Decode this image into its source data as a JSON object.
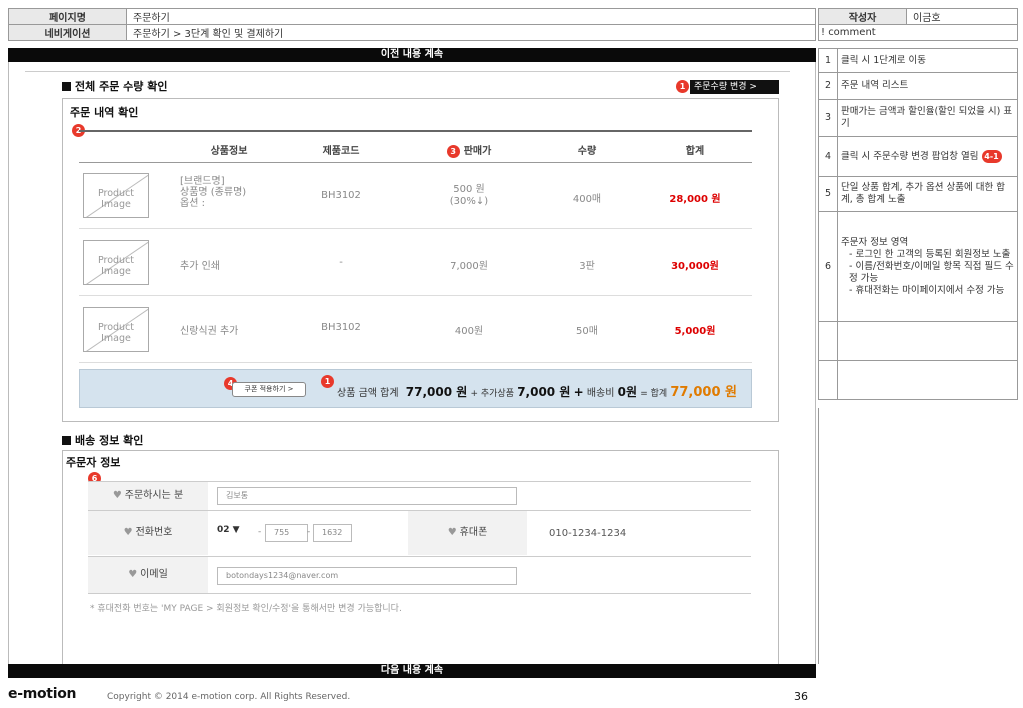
{
  "header": {
    "page_label": "페이지명",
    "page_value": "주문하기",
    "nav_label": "네비게이션",
    "nav_value": "주문하기 > 3단계 확인 및 결제하기",
    "author_label": "작성자",
    "author_value": "이금호",
    "comment_label": "! comment"
  },
  "bars": {
    "top": "이전 내용 계속",
    "bottom": "다음 내용 계속"
  },
  "comments": [
    {
      "num": "1",
      "text": "클릭 시 1단계로 이동"
    },
    {
      "num": "2",
      "text": "주문 내역 리스트"
    },
    {
      "num": "3",
      "text": "판매가는 금액과 할인율(할인 되었을 시) 표기"
    },
    {
      "num": "4",
      "text": "클릭 시 주문수량 변경 팝업창 열림",
      "badge": "4-1"
    },
    {
      "num": "5",
      "text": "단일 상품 합계, 추가 옵션 상품에 대한 합계, 총 합계 노출"
    },
    {
      "num": "6",
      "title": "주문자 정보 영역",
      "bullets": [
        "로그인 한 고객의 등록된 회원정보 노출",
        "이름/전화번호/이메일 항목 직접 필드 수정 가능",
        "휴대전화는 마이페이지에서 수정 가능"
      ]
    }
  ],
  "order": {
    "section_title": "전체 주문 수량 확인",
    "change_qty_badge": "1",
    "change_qty_button": "주문수량 변경 >",
    "subtitle": "주문 내역 확인",
    "list_badge": "2",
    "price_badge": "3",
    "columns": [
      "상품정보",
      "제품코드",
      "판매가",
      "수량",
      "합계"
    ],
    "image_placeholder": "Product Image",
    "rows": [
      {
        "info": [
          "[브랜드명]",
          "상품명 (종류명)",
          "옵션 :"
        ],
        "code": "BH3102",
        "price": [
          "500 원",
          "(30%↓)"
        ],
        "qty": "400매",
        "total": "28,000 원"
      },
      {
        "info": [
          "추가 인쇄"
        ],
        "code": "-",
        "price": [
          "7,000원"
        ],
        "qty": "3판",
        "total": "30,000원"
      },
      {
        "info": [
          "신랑식권 추가"
        ],
        "code": "BH3102",
        "price": [
          "400원"
        ],
        "qty": "50매",
        "total": "5,000원"
      }
    ],
    "summary": {
      "coupon_badge": "4",
      "coupon_button": "쿠폰 적용하기 >",
      "sum_badge": "1",
      "product_label": "상품 금액 합계",
      "product_amount": "77,000 원",
      "plus1": "+ 추가상품",
      "extra_amount": "7,000 원",
      "plus2": "+",
      "ship_label": "배송비",
      "ship_amount": "0원",
      "eq_label": "= 합계",
      "total_amount": "77,000 원"
    }
  },
  "delivery": {
    "section_title": "배송 정보 확인",
    "subtitle": "주문자 정보",
    "badge": "6",
    "name_label": "주문하시는 분",
    "name_value": "김보통",
    "phone_label": "전화번호",
    "phone_prefix": "02",
    "phone_mid": "755",
    "phone_last": "1632",
    "mobile_label": "휴대폰",
    "mobile_value": "010-1234-1234",
    "email_label": "이메일",
    "email_value": "botondays1234@naver.com",
    "note": "* 휴대전화 번호는 'MY PAGE > 회원정보 확인/수정'을 통해서만 변경 가능합니다."
  },
  "footer": {
    "logo": "e-motion",
    "copyright": "Copyright © 2014 e-motion corp. All Rights Reserved.",
    "page": "36"
  },
  "colors": {
    "badge": "#e8392b",
    "total_red": "#dd0000",
    "total_orange": "#e07b00",
    "summary_bg": "#d5e3ee"
  }
}
